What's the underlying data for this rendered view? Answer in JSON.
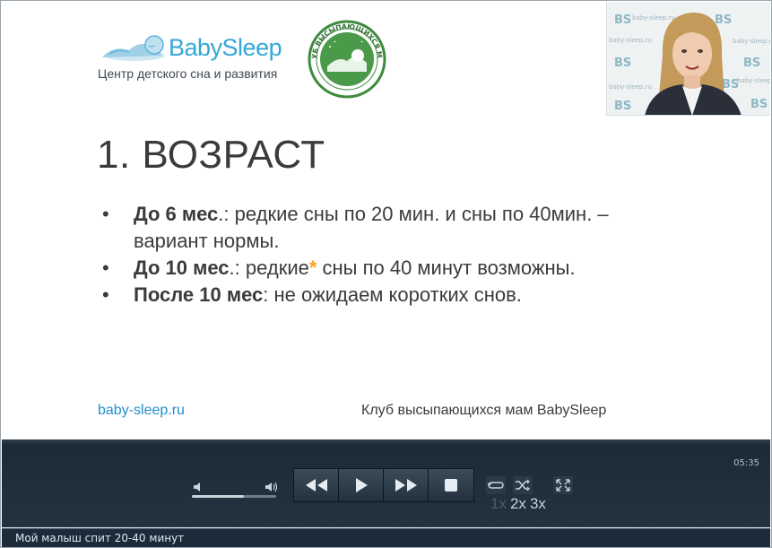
{
  "slide": {
    "logo": {
      "brand": "BabySleep",
      "tagline": "Центр детского сна и развития"
    },
    "seal_text": "КЛУБ ВЫСЫПАЮЩИХСЯ МАМ",
    "title": "1. ВОЗРАСТ",
    "bullets": [
      {
        "bold": "До 6 мес",
        "rest": ".: редкие сны по 20 мин. и сны по 40мин. – вариант нормы.",
        "star": ""
      },
      {
        "bold": "До 10 мес",
        "rest_before": ".:  редкие",
        "star": "*",
        "rest": " сны по 40 минут возможны."
      },
      {
        "bold": "После 10 мес",
        "rest": ": не ожидаем коротких снов.",
        "star": ""
      }
    ],
    "footer_left": "baby-sleep.ru",
    "footer_right": "Клуб высыпающихся мам BabySleep"
  },
  "webcam": {
    "watermark": "baby-sleep.ru"
  },
  "player": {
    "elapsed": "05:35",
    "volume_level": 0.62,
    "speeds": [
      "1x",
      "2x",
      "3x"
    ],
    "active_speed": "1x"
  },
  "statusbar": {
    "caption": "Мой малыш спит 20-40 минут"
  },
  "colors": {
    "brand_blue": "#35a7d6",
    "link_blue": "#1f8fcf",
    "star_orange": "#f5a623",
    "seal_green": "#3d8b3d",
    "player_bg": "#22323f"
  }
}
